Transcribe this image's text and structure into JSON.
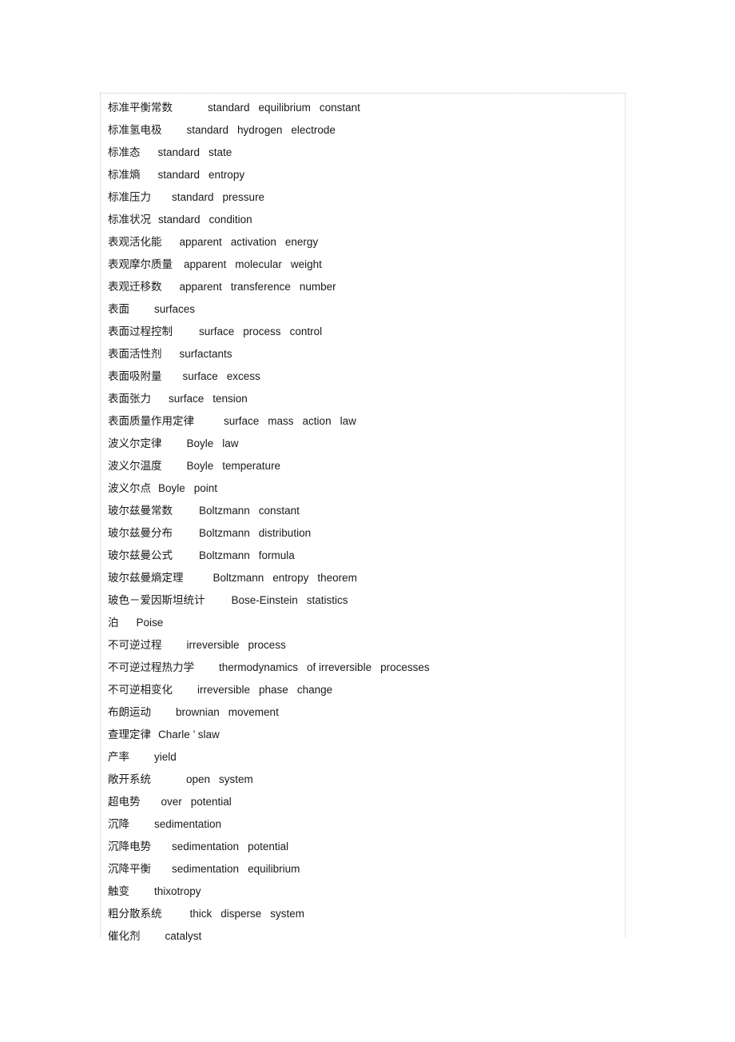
{
  "document": {
    "type": "bilingual-glossary",
    "language_pair": "Chinese-English",
    "subject": "physical chemistry terminology",
    "row_count": 36
  },
  "entries": [
    {
      "term": "标准平衡常数",
      "indent": 44,
      "gloss": [
        "standard",
        "equilibrium",
        "constant"
      ]
    },
    {
      "term": "标准氢电极",
      "indent": 31,
      "gloss": [
        "standard",
        "hydrogen",
        "electrode"
      ]
    },
    {
      "term": "标准态",
      "indent": 22,
      "gloss": [
        "standard",
        "state"
      ]
    },
    {
      "term": "标准熵",
      "indent": 22,
      "gloss": [
        "standard",
        "entropy"
      ]
    },
    {
      "term": "标准压力",
      "indent": 26,
      "gloss": [
        "standard",
        "pressure"
      ]
    },
    {
      "term": "标准状况",
      "indent": 9,
      "gloss": [
        "standard",
        "condition"
      ]
    },
    {
      "term": "表观活化能",
      "indent": 22,
      "gloss": [
        "apparent",
        "activation",
        "energy"
      ]
    },
    {
      "term": "表观摩尔质量",
      "indent": 14,
      "gloss": [
        "apparent",
        "molecular",
        "weight"
      ]
    },
    {
      "term": "表观迁移数",
      "indent": 22,
      "gloss": [
        "apparent",
        "transference",
        "number"
      ]
    },
    {
      "term": "表面",
      "indent": 31,
      "gloss": [
        "surfaces"
      ]
    },
    {
      "term": "表面过程控制",
      "indent": 33,
      "gloss": [
        "surface",
        "process",
        "control"
      ]
    },
    {
      "term": "表面活性剂",
      "indent": 22,
      "gloss": [
        "surfactants"
      ]
    },
    {
      "term": "表面吸附量",
      "indent": 26,
      "gloss": [
        "surface",
        "excess"
      ]
    },
    {
      "term": "表面张力",
      "indent": 22,
      "gloss": [
        "surface",
        "tension"
      ]
    },
    {
      "term": "表面质量作用定律",
      "indent": 37,
      "gloss": [
        "surface",
        "mass",
        "action",
        "law"
      ]
    },
    {
      "term": "波义尔定律",
      "indent": 31,
      "gloss": [
        "Boyle",
        "law"
      ]
    },
    {
      "term": "波义尔温度",
      "indent": 31,
      "gloss": [
        "Boyle",
        "temperature"
      ]
    },
    {
      "term": "波义尔点",
      "indent": 9,
      "gloss": [
        "Boyle",
        "point"
      ]
    },
    {
      "term": "玻尔兹曼常数",
      "indent": 33,
      "gloss": [
        "Boltzmann",
        "constant"
      ]
    },
    {
      "term": "玻尔兹曼分布",
      "indent": 33,
      "gloss": [
        "Boltzmann",
        "distribution"
      ]
    },
    {
      "term": "玻尔兹曼公式",
      "indent": 33,
      "gloss": [
        "Boltzmann",
        "formula"
      ]
    },
    {
      "term": "玻尔兹曼熵定理",
      "indent": 37,
      "gloss": [
        "Boltzmann",
        "entropy",
        "theorem"
      ]
    },
    {
      "term": "玻色－爱因斯坦统计",
      "indent": 33,
      "gloss": [
        "Bose-Einstein",
        "statistics"
      ]
    },
    {
      "term": "泊",
      "indent": 22,
      "gloss": [
        "Poise"
      ]
    },
    {
      "term": "不可逆过程",
      "indent": 31,
      "gloss": [
        "irreversible",
        "process"
      ]
    },
    {
      "term": "不可逆过程热力学",
      "indent": 31,
      "gloss": [
        "thermodynamics",
        "of irreversible",
        "processes"
      ]
    },
    {
      "term": "不可逆相变化",
      "indent": 31,
      "gloss": [
        "irreversible",
        "phase",
        "change"
      ]
    },
    {
      "term": "布朗运动",
      "indent": 31,
      "gloss": [
        "brownian",
        "movement"
      ]
    },
    {
      "term": "查理定律",
      "indent": 9,
      "gloss": [
        "Charle ’ slaw"
      ]
    },
    {
      "term": "产率",
      "indent": 31,
      "gloss": [
        "yield"
      ]
    },
    {
      "term": "敞开系统",
      "indent": 44,
      "gloss": [
        "open",
        "system"
      ]
    },
    {
      "term": "超电势",
      "indent": 26,
      "gloss": [
        "over",
        "potential"
      ]
    },
    {
      "term": "沉降",
      "indent": 31,
      "gloss": [
        "sedimentation"
      ]
    },
    {
      "term": "沉降电势",
      "indent": 26,
      "gloss": [
        "sedimentation",
        "potential"
      ]
    },
    {
      "term": "沉降平衡",
      "indent": 26,
      "gloss": [
        "sedimentation",
        "equilibrium"
      ]
    },
    {
      "term": "触变",
      "indent": 31,
      "gloss": [
        "thixotropy"
      ]
    },
    {
      "term": "粗分散系统",
      "indent": 35,
      "gloss": [
        "thick",
        "disperse",
        "system"
      ]
    },
    {
      "term": "催化剂",
      "indent": 31,
      "gloss": [
        "catalyst"
      ]
    }
  ]
}
